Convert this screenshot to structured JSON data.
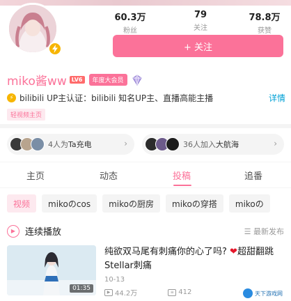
{
  "profile": {
    "name": "miko酱ww",
    "level": "LV6",
    "vip_label": "年度大会员",
    "auth_prefix": "bilibili",
    "auth_text": "UP主认证：bilibili 知名UP主、直播高能主播",
    "detail_link": "详情",
    "tag": "轻视频主页"
  },
  "stats": [
    {
      "value": "60.3万",
      "label": "粉丝"
    },
    {
      "value": "79",
      "label": "关注"
    },
    {
      "value": "78.8万",
      "label": "获赞"
    }
  ],
  "follow_button": "+ 关注",
  "cards": [
    {
      "count_text": "4人为",
      "emph": "Ta充电"
    },
    {
      "count_text": "36人加入",
      "emph": "大航海"
    }
  ],
  "tabs": [
    "主页",
    "动态",
    "投稿",
    "追番"
  ],
  "active_tab": "投稿",
  "chips": [
    "视频",
    "mikoのcos",
    "mikoの厨房",
    "mikoの穿搭",
    "mikoの"
  ],
  "playlist": {
    "label": "连续播放",
    "sort": "最新发布"
  },
  "video": {
    "title_part1": "纯欲双马尾有刺痛你的心了吗?",
    "title_part2": "超甜翻跳Stellar刺痛",
    "duration": "01:35",
    "date": "10-13",
    "views": "44.2万",
    "comments": "412"
  },
  "watermark": "天下游戏网",
  "icons": [
    "bolt-icon",
    "medal-icon",
    "auth-icon",
    "chevron-right-icon",
    "play-icon",
    "sort-icon",
    "heart-icon",
    "view-icon",
    "comment-icon"
  ],
  "colors": {
    "accent": "#fb7299",
    "link": "#00a1d6",
    "gold": "#f7b500"
  }
}
